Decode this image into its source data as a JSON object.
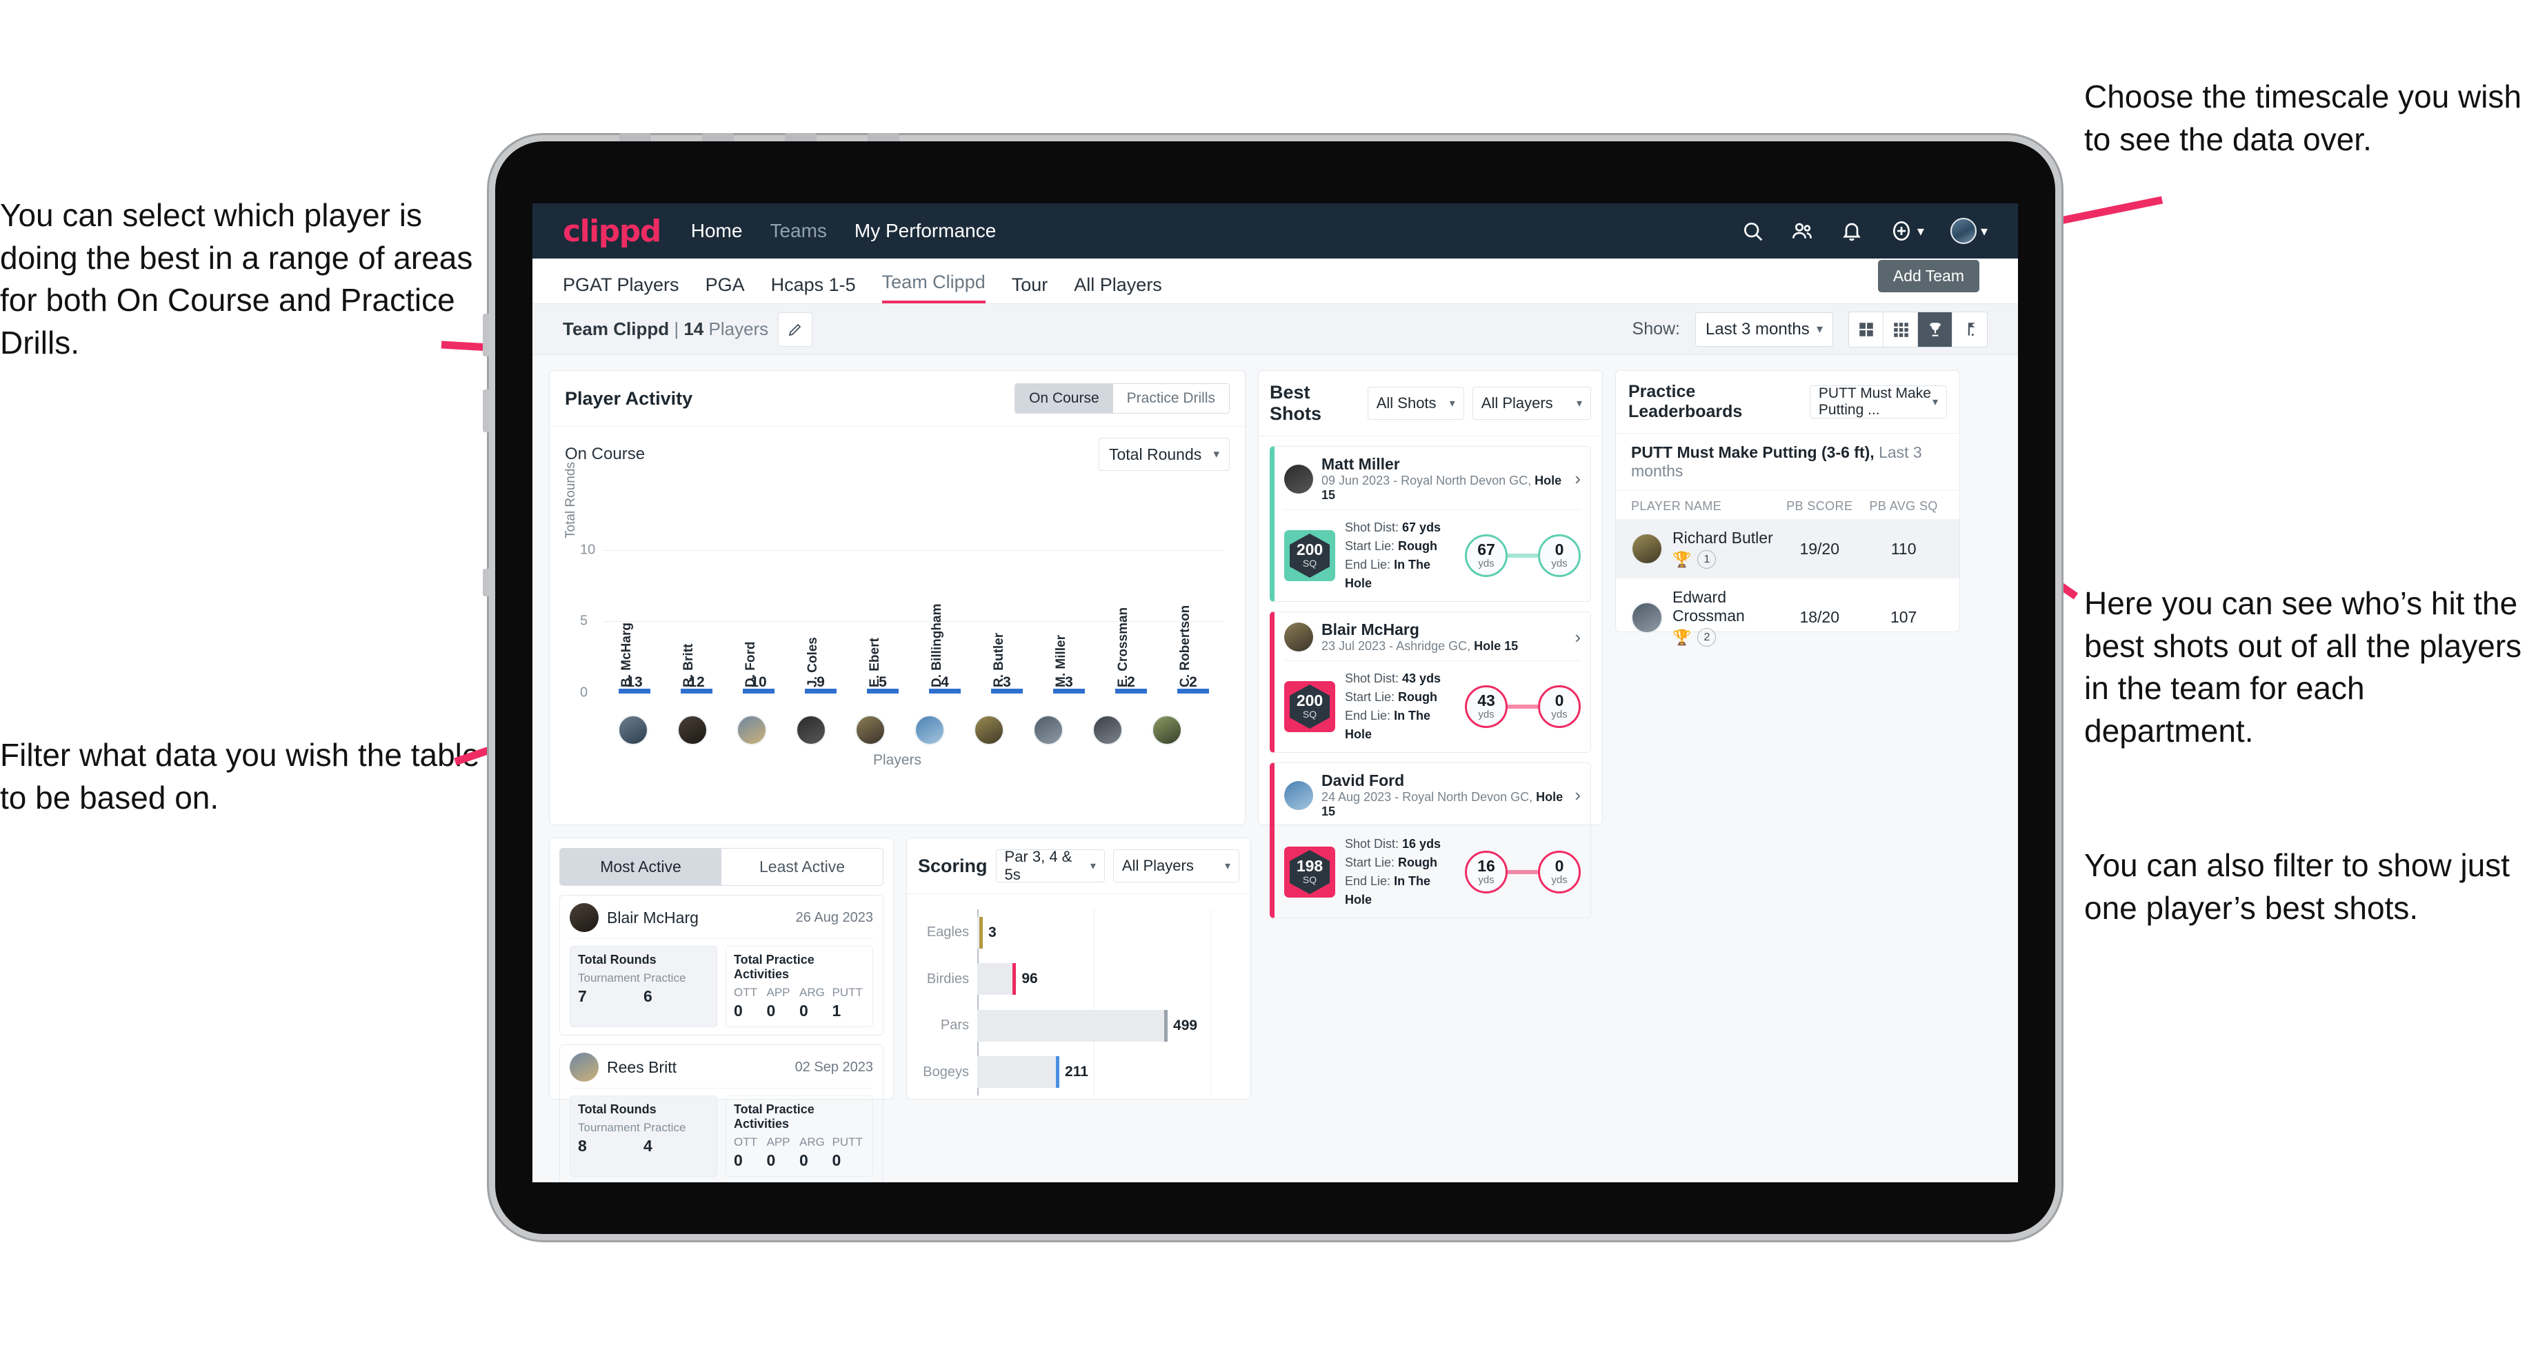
{
  "annotations": {
    "left_top": "You can select which player is doing the best in a range of areas for both On Course and Practice Drills.",
    "left_bottom": "Filter what data you wish the table to be based on.",
    "right_top": "Choose the timescale you wish to see the data over.",
    "right_mid": "Here you can see who’s hit the best shots out of all the players in the team for each department.",
    "right_bottom": "You can also filter to show just one player’s best shots."
  },
  "navbar": {
    "logo": "clippd",
    "links": [
      {
        "label": "Home",
        "active": true
      },
      {
        "label": "Teams",
        "active": false
      },
      {
        "label": "My Performance",
        "active": true
      }
    ],
    "icons": [
      "search-icon",
      "people-icon",
      "bell-icon",
      "plus-circle-icon",
      "avatar"
    ]
  },
  "tabs": [
    {
      "label": "PGAT Players",
      "active": false
    },
    {
      "label": "PGA",
      "active": false
    },
    {
      "label": "Hcaps 1-5",
      "active": false
    },
    {
      "label": "Team Clippd",
      "active": true
    },
    {
      "label": "Tour",
      "active": false
    },
    {
      "label": "All Players",
      "active": false
    }
  ],
  "tooltip": {
    "add_team": "Add Team"
  },
  "toolbar": {
    "team_name": "Team Clippd",
    "separator": "|",
    "player_count": "14",
    "players_word": "Players",
    "edit_icon": "pencil-icon",
    "show_label": "Show:",
    "period_value": "Last 3 months",
    "view_buttons": [
      {
        "icon": "grid-4-icon",
        "active": false
      },
      {
        "icon": "grid-9-icon",
        "active": false
      },
      {
        "icon": "trophy-icon",
        "active": true
      },
      {
        "icon": "golf-flag-icon",
        "active": false
      }
    ]
  },
  "player_activity": {
    "title": "Player Activity",
    "segments": [
      {
        "label": "On Course",
        "active": true
      },
      {
        "label": "Practice Drills",
        "active": false
      }
    ],
    "sub_label": "On Course",
    "metric_select": "Total Rounds"
  },
  "chart_data": [
    {
      "type": "bar",
      "title": "Player Activity – On Course",
      "xlabel": "Players",
      "ylabel": "Total Rounds",
      "categories": [
        "B. McHarg",
        "R. Britt",
        "D. Ford",
        "J. Coles",
        "E. Ebert",
        "D. Billingham",
        "R. Butler",
        "M. Miller",
        "E. Crossman",
        "C. Robertson"
      ],
      "values": [
        13,
        12,
        10,
        9,
        5,
        4,
        3,
        3,
        2,
        2
      ],
      "ylim": [
        0,
        14
      ],
      "yticks": [
        0,
        5,
        10
      ],
      "grid": true,
      "bar_color": "#e5e8ed",
      "cap_color": "#2f6fd0"
    },
    {
      "type": "bar",
      "orientation": "horizontal",
      "title": "Scoring",
      "categories": [
        "Eagles",
        "Birdies",
        "Pars",
        "Bogeys"
      ],
      "values": [
        3,
        96,
        499,
        211
      ],
      "value_labels": [
        "3",
        "96",
        "499",
        "211"
      ],
      "cap_colors": [
        "#b3983f",
        "#ef2b63",
        "#9aa3ab",
        "#4a90e2"
      ],
      "bar_color": "#e8eaee",
      "xlim": [
        0,
        620
      ],
      "grid": true
    }
  ],
  "best_shots": {
    "title": "Best Shots",
    "shot_filter": "All Shots",
    "player_filter": "All Players",
    "cards": [
      {
        "player": "Matt Miller",
        "meta_date": "09 Jun 2023",
        "meta_course": "Royal North Devon GC,",
        "meta_hole": "Hole 15",
        "sq_value": "200",
        "sq_unit": "SQ",
        "shot_dist_label": "Shot Dist:",
        "shot_dist": "67 yds",
        "start_lie_label": "Start Lie:",
        "start_lie": "Rough",
        "end_lie_label": "End Lie:",
        "end_lie": "In The Hole",
        "from_value": "67",
        "from_unit": "yds",
        "to_value": "0",
        "to_unit": "yds",
        "accent": "#5ecfb1"
      },
      {
        "player": "Blair McHarg",
        "meta_date": "23 Jul 2023",
        "meta_course": "Ashridge GC,",
        "meta_hole": "Hole 15",
        "sq_value": "200",
        "sq_unit": "SQ",
        "shot_dist_label": "Shot Dist:",
        "shot_dist": "43 yds",
        "start_lie_label": "Start Lie:",
        "start_lie": "Rough",
        "end_lie_label": "End Lie:",
        "end_lie": "In The Hole",
        "from_value": "43",
        "from_unit": "yds",
        "to_value": "0",
        "to_unit": "yds",
        "accent": "#ef2b63"
      },
      {
        "player": "David Ford",
        "meta_date": "24 Aug 2023",
        "meta_course": "Royal North Devon GC,",
        "meta_hole": "Hole 15",
        "sq_value": "198",
        "sq_unit": "SQ",
        "shot_dist_label": "Shot Dist:",
        "shot_dist": "16 yds",
        "start_lie_label": "Start Lie:",
        "start_lie": "Rough",
        "end_lie_label": "End Lie:",
        "end_lie": "In The Hole",
        "from_value": "16",
        "from_unit": "yds",
        "to_value": "0",
        "to_unit": "yds",
        "accent": "#ef2b63"
      }
    ]
  },
  "practice_leaderboards": {
    "title": "Practice Leaderboards",
    "drill_select": "PUTT Must Make Putting ...",
    "subtitle_bold": "PUTT Must Make Putting (3-6 ft),",
    "subtitle_light": "Last 3 months",
    "columns": [
      "PLAYER NAME",
      "PB SCORE",
      "PB AVG SQ"
    ],
    "rows": [
      {
        "name": "Richard Butler",
        "trophy": "gold",
        "rank": "1",
        "pb_score": "19/20",
        "pb_avg_sq": "110"
      },
      {
        "name": "Edward Crossman",
        "trophy": "silver",
        "rank": "2",
        "pb_score": "18/20",
        "pb_avg_sq": "107"
      }
    ]
  },
  "activity_panel": {
    "tabs": [
      {
        "label": "Most Active",
        "active": true
      },
      {
        "label": "Least Active",
        "active": false
      }
    ],
    "cards": [
      {
        "player": "Blair McHarg",
        "date": "26 Aug 2023",
        "rounds_title": "Total Rounds",
        "rounds_keys": [
          "Tournament",
          "Practice"
        ],
        "rounds_values": [
          "7",
          "6"
        ],
        "practice_title": "Total Practice Activities",
        "practice_keys": [
          "OTT",
          "APP",
          "ARG",
          "PUTT"
        ],
        "practice_values": [
          "0",
          "0",
          "0",
          "1"
        ]
      },
      {
        "player": "Rees Britt",
        "date": "02 Sep 2023",
        "rounds_title": "Total Rounds",
        "rounds_keys": [
          "Tournament",
          "Practice"
        ],
        "rounds_values": [
          "8",
          "4"
        ],
        "practice_title": "Total Practice Activities",
        "practice_keys": [
          "OTT",
          "APP",
          "ARG",
          "PUTT"
        ],
        "practice_values": [
          "0",
          "0",
          "0",
          "0"
        ]
      }
    ]
  },
  "scoring": {
    "title": "Scoring",
    "par_select": "Par 3, 4 & 5s",
    "player_select": "All Players"
  },
  "colors": {
    "brand_pink": "#ef2b63",
    "navbar": "#1b2b3a",
    "bar_blue": "#2f6fd0",
    "teal": "#5ecfb1"
  }
}
